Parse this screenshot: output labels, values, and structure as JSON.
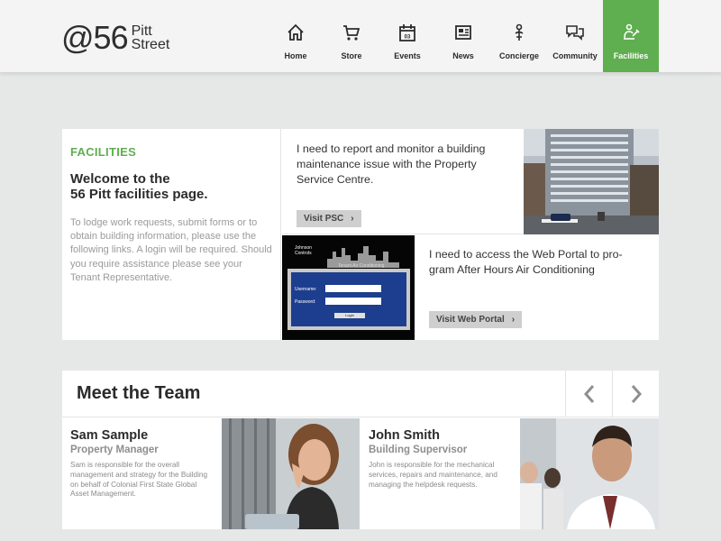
{
  "header": {
    "logo": {
      "main": "@56",
      "line1": "Pitt",
      "line2": "Street"
    },
    "nav": [
      {
        "label": "Home",
        "icon": "home-icon"
      },
      {
        "label": "Store",
        "icon": "cart-icon"
      },
      {
        "label": "Events",
        "icon": "calendar-icon",
        "badge": "03"
      },
      {
        "label": "News",
        "icon": "newspaper-icon"
      },
      {
        "label": "Concierge",
        "icon": "concierge-icon"
      },
      {
        "label": "Community",
        "icon": "chat-bubbles-icon"
      },
      {
        "label": "Facilities",
        "icon": "facilities-icon",
        "active": true
      }
    ],
    "active_color": "#5fae4f"
  },
  "facilities": {
    "tag": "FACILITIES",
    "title_line1": "Welcome to the",
    "title_line2": "56 Pitt facilities page.",
    "body": "To lodge work requests, submit forms or to obtain building information, please use the following links. A login will be required. Should you require assistance please see your Tenant Representative.",
    "psc": {
      "text": "I need to report and monitor a building maintenance issue with the Property Service Centre.",
      "button": "Visit PSC"
    },
    "portal": {
      "text": "I need to access the Web Portal to pro-gram After Hours Air Conditioning",
      "button": "Visit Web Portal"
    },
    "login_image": {
      "brand_line1": "Johnson",
      "brand_line2": "Controls",
      "section": "Tenant Air Conditioning",
      "username_label": "Username:",
      "password_label": "Password:",
      "login_button": "Login"
    }
  },
  "team": {
    "title": "Meet the Team",
    "members": [
      {
        "name": "Sam Sample",
        "role": "Property Manager",
        "desc": "Sam is responsible for the overall management and strategy for the Building on behalf of Colonial First State Global Asset Management."
      },
      {
        "name": "John Smith",
        "role": "Building Supervisor",
        "desc": "John is responsible for the mechanical services, repairs and maintenance, and managing the helpdesk requests."
      }
    ]
  }
}
